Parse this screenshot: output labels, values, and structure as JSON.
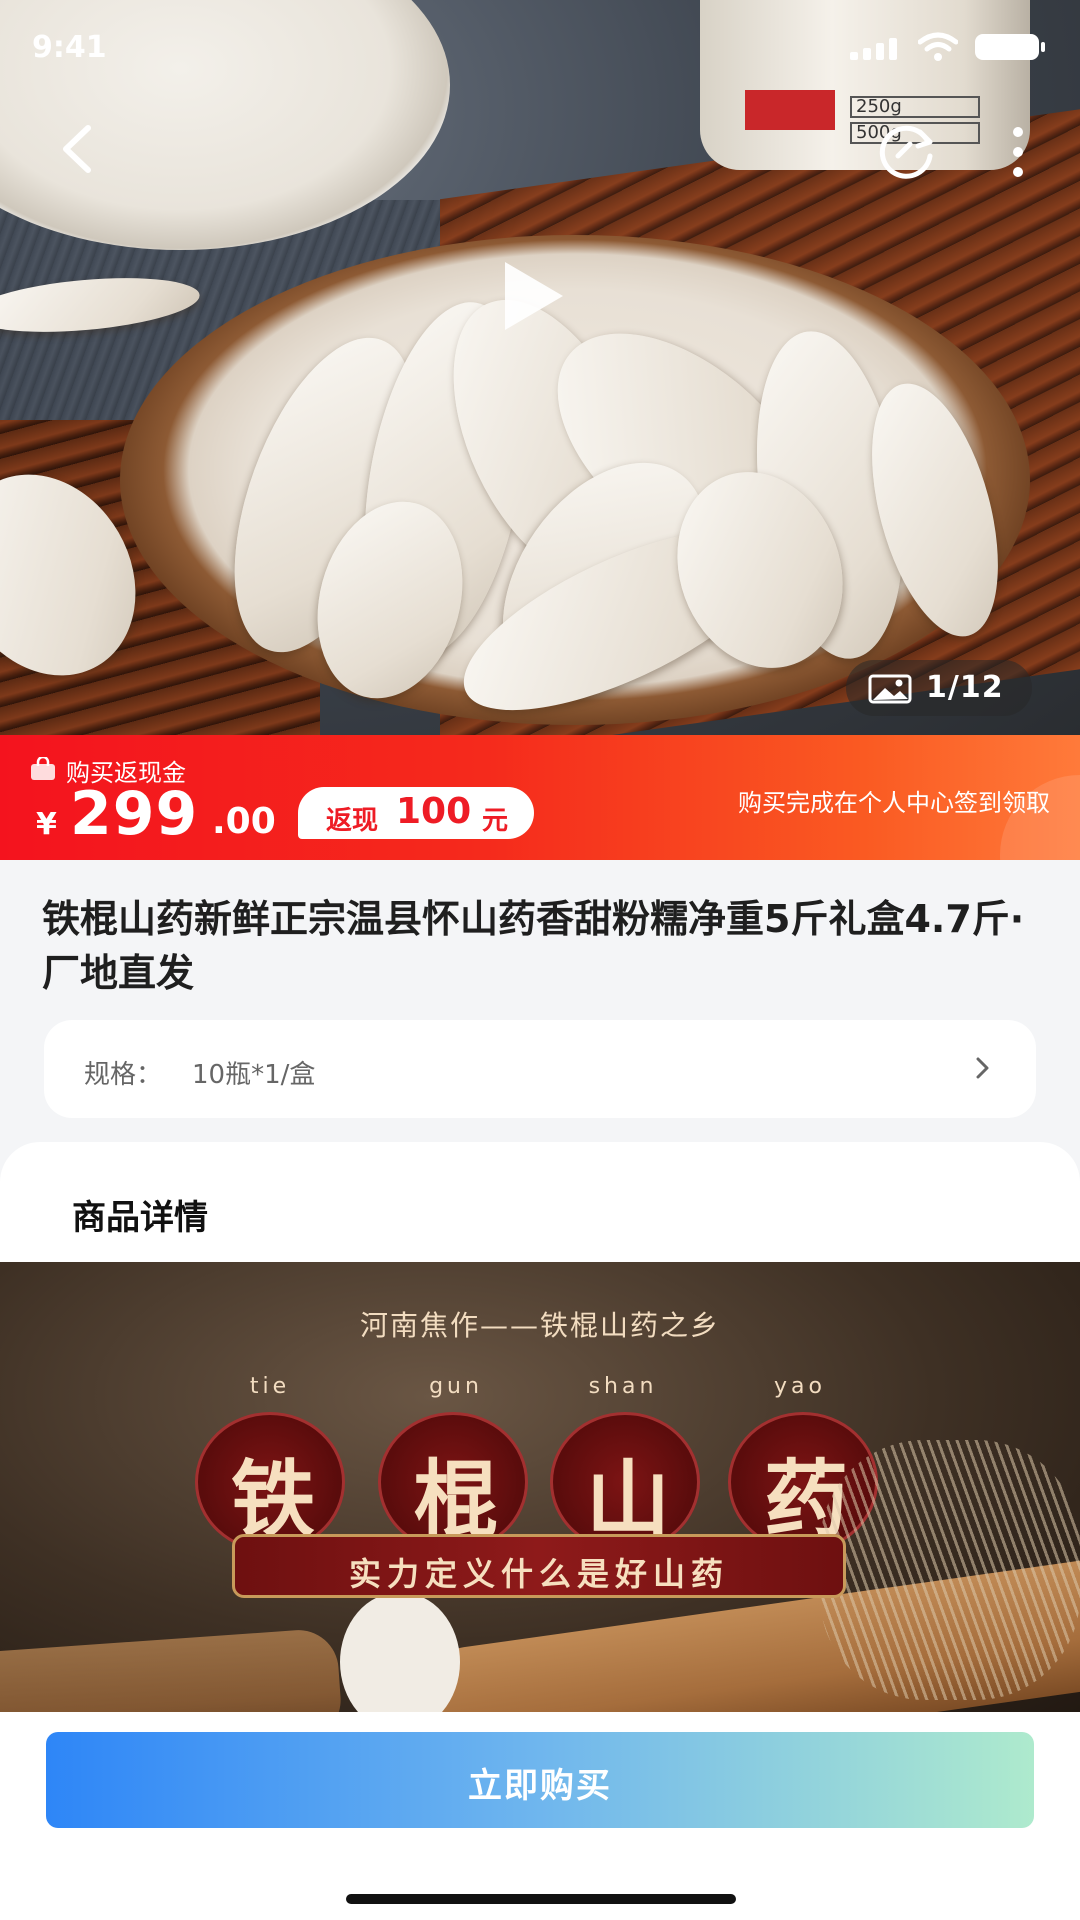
{
  "status_bar": {
    "time": "9:41"
  },
  "gallery": {
    "counter": "1/12",
    "jar_options": [
      "250g",
      "500g"
    ]
  },
  "price": {
    "cash_label": "购买返现金",
    "currency": "¥",
    "integer": "299",
    "decimal": ".00",
    "cashback_prefix": "返现",
    "cashback_amount": "100",
    "cashback_unit": "元",
    "tip": "购买完成在个人中心签到领取"
  },
  "product": {
    "title": "铁棍山药新鲜正宗温县怀山药香甜粉糯净重5斤礼盒4.7斤·厂地直发",
    "spec_label": "规格：",
    "spec_value": "10瓶*1/盒"
  },
  "detail": {
    "section_title": "商品详情",
    "banner_subtitle": "河南焦作——铁棍山药之乡",
    "characters": [
      {
        "pinyin": "tie",
        "hanzi": "铁"
      },
      {
        "pinyin": "gun",
        "hanzi": "棍"
      },
      {
        "pinyin": "shan",
        "hanzi": "山"
      },
      {
        "pinyin": "yao",
        "hanzi": "药"
      }
    ],
    "slogan": "实力定义什么是好山药"
  },
  "actions": {
    "buy_label": "立即购买"
  },
  "colors": {
    "price_bar_start": "#f4131e",
    "price_bar_end": "#ff7a3a",
    "button_start": "#2e86f7",
    "button_end": "#aeeacd",
    "cashback_text": "#ee1c25"
  }
}
